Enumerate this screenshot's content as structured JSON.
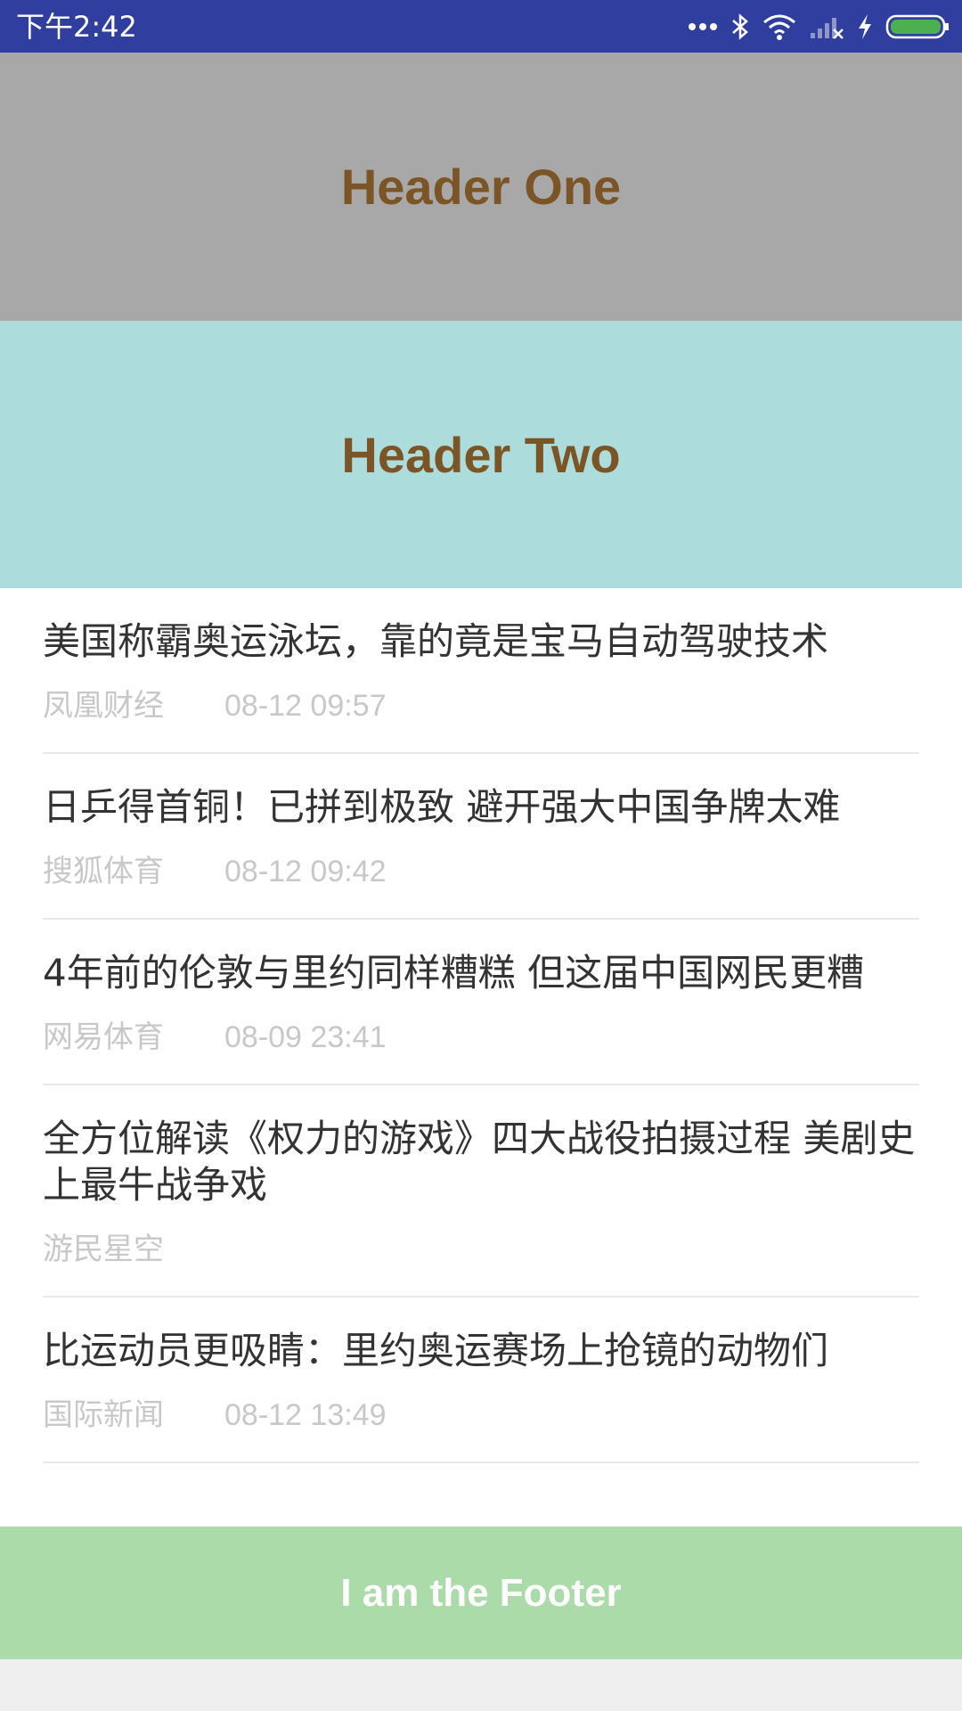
{
  "status_bar": {
    "time": "下午2:42",
    "icons": [
      "more-dots-icon",
      "bluetooth-icon",
      "wifi-icon",
      "no-signal-icon",
      "charging-icon",
      "battery-icon"
    ],
    "battery_color": "#4caf50"
  },
  "header_one": {
    "title": "Header One",
    "background": "#a8a8a8"
  },
  "header_two": {
    "title": "Header Two",
    "background": "#acdcdc"
  },
  "news": [
    {
      "title": "美国称霸奥运泳坛，靠的竟是宝马自动驾驶技术",
      "source": "凤凰财经",
      "time": "08-12 09:57"
    },
    {
      "title": "日乒得首铜！已拼到极致 避开强大中国争牌太难",
      "source": "搜狐体育",
      "time": "08-12 09:42"
    },
    {
      "title": "4年前的伦敦与里约同样糟糕 但这届中国网民更糟",
      "source": "网易体育",
      "time": "08-09 23:41"
    },
    {
      "title": "全方位解读《权力的游戏》四大战役拍摄过程 美剧史上最牛战争戏",
      "source": "游民星空",
      "time": ""
    },
    {
      "title": "比运动员更吸睛：里约奥运赛场上抢镜的动物们",
      "source": "国际新闻",
      "time": "08-12 13:49"
    }
  ],
  "footer": {
    "text": "I am the Footer",
    "background": "#aadba8"
  }
}
